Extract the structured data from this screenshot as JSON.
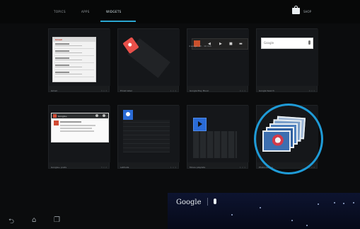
{
  "tabs": [
    {
      "label": "TOPICS"
    },
    {
      "label": "APPS"
    },
    {
      "label": "WIDGETS",
      "active": true
    }
  ],
  "shop": {
    "label": "SHOP",
    "icon": "shopping-bag-icon"
  },
  "widgets": [
    {
      "label": "Gmail",
      "size": "3 × 3"
    },
    {
      "label": "Email label",
      "size": "1 × 1"
    },
    {
      "label": "Google Play Music",
      "size": "4 × 1"
    },
    {
      "label": "Google Search",
      "size": "4 × 1"
    },
    {
      "label": "Google+ posts",
      "size": "3 × 2"
    },
    {
      "label": "Latitude",
      "size": "1 × 1"
    },
    {
      "label": "Movie playlists",
      "size": "1 × 1"
    },
    {
      "label": "Photo Gallery",
      "size": "2 × 2"
    }
  ],
  "gmail_preview": {
    "header": "Gmail"
  },
  "music_preview": {
    "text": "4 songs · 2h · 10 min",
    "controls": [
      "◀",
      "▶",
      "■",
      "▬"
    ]
  },
  "gsearch_preview": {
    "placeholder": "Google"
  },
  "gplus_preview": {
    "header": "Google+"
  },
  "google_bar": {
    "logo": "Google",
    "icon": "microphone-icon"
  },
  "nav": {
    "back_icon": "back-icon",
    "home_icon": "home-icon",
    "recents_icon": "recent-apps-icon"
  },
  "colors": {
    "accent": "#2aa6d1",
    "highlight_ring": "#1f9bd7"
  }
}
